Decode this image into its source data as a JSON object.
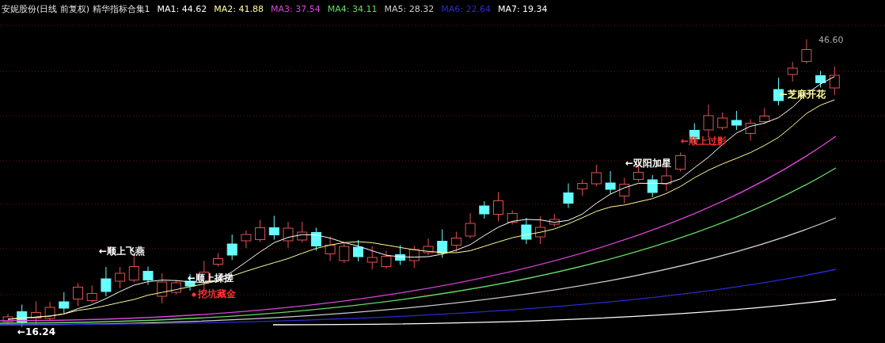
{
  "header": {
    "title": "安妮股份(日线 前复权) 精华指标合集1",
    "ma_values": [
      {
        "text": "MA1: 44.62",
        "color": "#ffffff"
      },
      {
        "text": "MA2: 41.88",
        "color": "#ffff99"
      },
      {
        "text": "MA3: 37.54",
        "color": "#dd44dd"
      },
      {
        "text": "MA4: 34.11",
        "color": "#66dd66"
      },
      {
        "text": "MA5: 28.32",
        "color": "#cccccc"
      },
      {
        "text": "MA6: 22.64",
        "color": "#2b2bd0"
      },
      {
        "text": "MA7: 19.34",
        "color": "#ffffff"
      }
    ]
  },
  "chart": {
    "high_label": "46.60",
    "annotations": [
      {
        "text": "←顺上飞燕",
        "color": "#ffffff"
      },
      {
        "text": "←顺上揉搓",
        "color": "#ffffff"
      },
      {
        "text": "挖坑藏金",
        "color": "#ff3333"
      },
      {
        "text": "←16.24",
        "color": "#ffffff"
      },
      {
        "text": "←双阳加星",
        "color": "#ffffff"
      },
      {
        "text": "←顺上过影",
        "color": "#ff3333"
      },
      {
        "text": "←芝麻开花",
        "color": "#ffff99"
      }
    ]
  }
}
